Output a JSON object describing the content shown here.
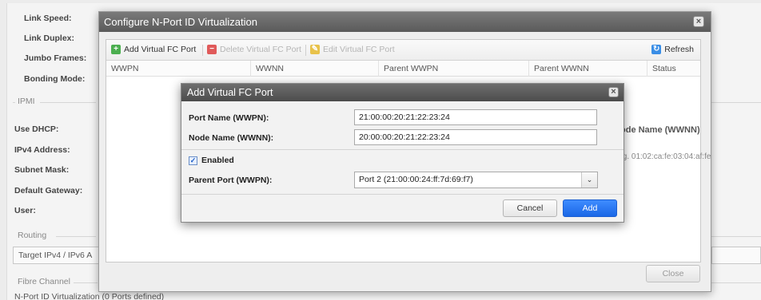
{
  "background": {
    "labels": [
      "Link Speed:",
      "Link Duplex:",
      "Jumbo Frames:",
      "Bonding Mode:"
    ],
    "ipmi": {
      "section": "IPMI",
      "labels": [
        "Use DHCP:",
        "IPv4 Address:",
        "Subnet Mask:",
        "Default Gateway:",
        "User:"
      ]
    },
    "routing": {
      "section": "Routing",
      "field": "Target IPv4 / IPv6 A"
    },
    "fibre": {
      "section": "Fibre Channel",
      "npiv_text": "N-Port ID Virtualization (0 Ports defined)"
    },
    "right_col": {
      "header": "ode Name (WWNN)",
      "hint": ".g. 01:02:ca:fe:03:04:af:fe"
    }
  },
  "outer_dialog": {
    "title": "Configure N-Port ID Virtualization",
    "toolbar": {
      "add": "Add Virtual FC Port",
      "delete": "Delete Virtual FC Port",
      "edit": "Edit Virtual FC Port",
      "refresh": "Refresh"
    },
    "columns": [
      "WWPN",
      "WWNN",
      "Parent WWPN",
      "Parent WWNN",
      "Status"
    ],
    "close_button": "Close"
  },
  "inner_dialog": {
    "title": "Add Virtual FC Port",
    "port_name_label": "Port Name (WWPN):",
    "port_name_value": "21:00:00:20:21:22:23:24",
    "node_name_label": "Node Name (WWNN):",
    "node_name_value": "20:00:00:20:21:22:23:24",
    "enabled_label": "Enabled",
    "enabled_checked": true,
    "parent_port_label": "Parent Port (WWPN):",
    "parent_port_value": "Port 2 (21:00:00:24:ff:7d:69:f7)",
    "cancel_button": "Cancel",
    "add_button": "Add"
  },
  "colors": {
    "title_bar": "#5a5a5a",
    "primary_button": "#1a67e6",
    "add_icon": "#4caf50",
    "delete_icon": "#e05a5a",
    "edit_icon": "#e8c24a",
    "refresh_icon": "#3a8ee6"
  },
  "icons": {
    "add": "plus-icon",
    "delete": "minus-icon",
    "edit": "pencil-icon",
    "refresh": "refresh-icon",
    "close": "close-icon",
    "check": "check-icon",
    "dropdown": "chevron-down-icon"
  }
}
